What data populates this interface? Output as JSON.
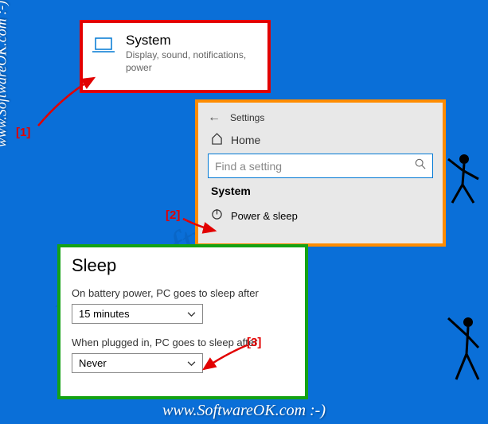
{
  "panel1": {
    "title": "System",
    "subtitle": "Display, sound, notifications, power"
  },
  "panel2": {
    "header": "Settings",
    "home": "Home",
    "search_placeholder": "Find a setting",
    "section": "System",
    "item_power": "Power & sleep"
  },
  "panel3": {
    "title": "Sleep",
    "battery_label": "On battery power, PC goes to sleep after",
    "battery_value": "15 minutes",
    "plugged_label": "When plugged in, PC goes to sleep after",
    "plugged_value": "Never"
  },
  "annotations": {
    "a1": "[1]",
    "a2": "[2]",
    "a3": "[3]"
  },
  "watermark": {
    "text": "www.SoftwareOK.com :-)"
  }
}
